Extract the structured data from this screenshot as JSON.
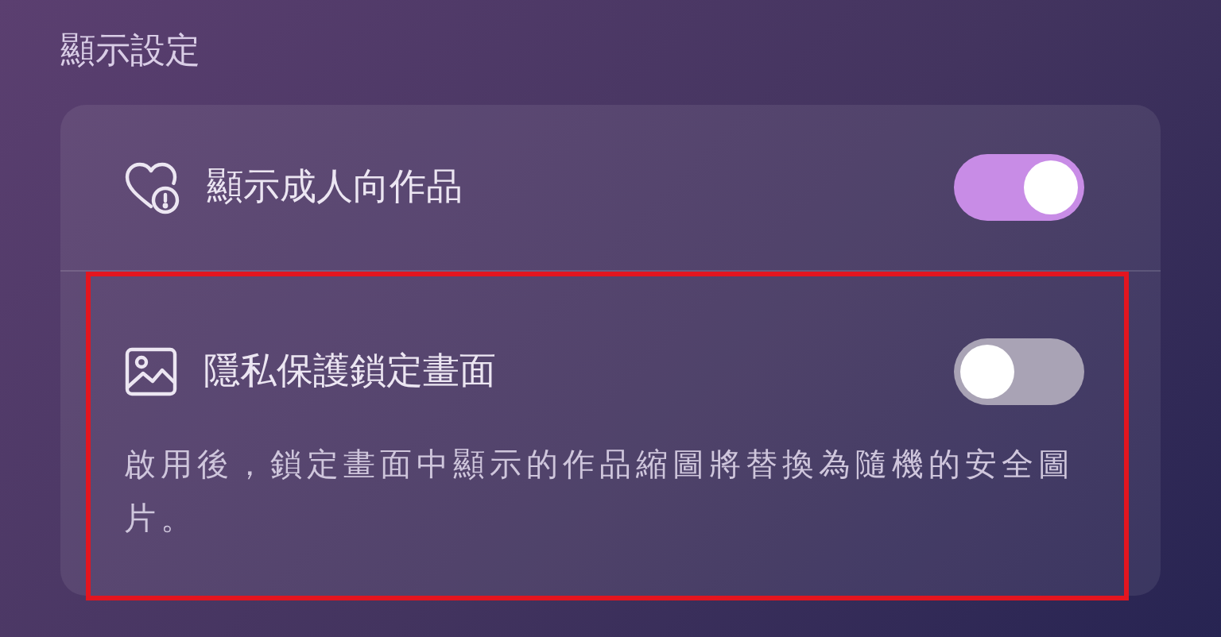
{
  "section_title": "顯示設定",
  "settings": [
    {
      "kind": "heart-alert",
      "label": "顯示成人向作品",
      "on": true,
      "highlighted": false
    },
    {
      "kind": "image",
      "label": "隱私保護鎖定畫面",
      "on": false,
      "highlighted": true,
      "description": "啟用後，鎖定畫面中顯示的作品縮圖將替換為隨機的安全圖片。"
    }
  ]
}
